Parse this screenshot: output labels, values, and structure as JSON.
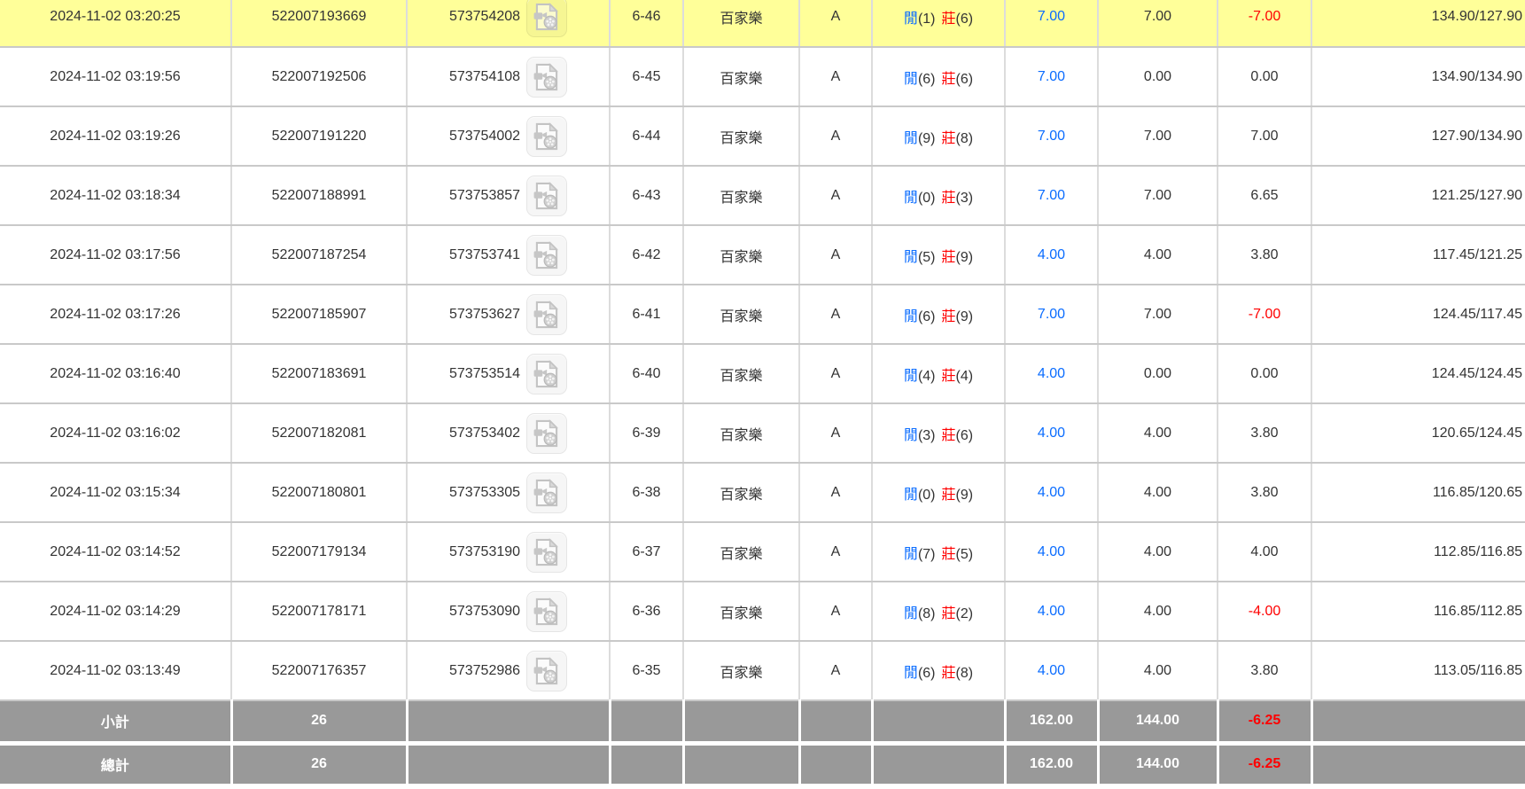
{
  "result_labels": {
    "player": "閒",
    "banker": "莊"
  },
  "icons": {
    "video": "video-file-icon"
  },
  "colors": {
    "highlight_yellow": "#ffff99",
    "bet_blue": "#0a6cff",
    "loss_red": "#ff0000",
    "summary_gray": "#999999",
    "text": "#333333"
  },
  "rows": [
    {
      "highlight": true,
      "time": "2024-11-02 03:20:25",
      "order_id": "522007193669",
      "round_id": "573754208",
      "round_no": "6-46",
      "game": "百家樂",
      "table": "A",
      "player_score": "(1)",
      "banker_score": "(6)",
      "bet": "7.00",
      "valid_bet": "7.00",
      "win_loss": "-7.00",
      "balance": "134.90/127.90"
    },
    {
      "highlight": false,
      "time": "2024-11-02 03:19:56",
      "order_id": "522007192506",
      "round_id": "573754108",
      "round_no": "6-45",
      "game": "百家樂",
      "table": "A",
      "player_score": "(6)",
      "banker_score": "(6)",
      "bet": "7.00",
      "valid_bet": "0.00",
      "win_loss": "0.00",
      "balance": "134.90/134.90"
    },
    {
      "highlight": false,
      "time": "2024-11-02 03:19:26",
      "order_id": "522007191220",
      "round_id": "573754002",
      "round_no": "6-44",
      "game": "百家樂",
      "table": "A",
      "player_score": "(9)",
      "banker_score": "(8)",
      "bet": "7.00",
      "valid_bet": "7.00",
      "win_loss": "7.00",
      "balance": "127.90/134.90"
    },
    {
      "highlight": false,
      "time": "2024-11-02 03:18:34",
      "order_id": "522007188991",
      "round_id": "573753857",
      "round_no": "6-43",
      "game": "百家樂",
      "table": "A",
      "player_score": "(0)",
      "banker_score": "(3)",
      "bet": "7.00",
      "valid_bet": "7.00",
      "win_loss": "6.65",
      "balance": "121.25/127.90"
    },
    {
      "highlight": false,
      "time": "2024-11-02 03:17:56",
      "order_id": "522007187254",
      "round_id": "573753741",
      "round_no": "6-42",
      "game": "百家樂",
      "table": "A",
      "player_score": "(5)",
      "banker_score": "(9)",
      "bet": "4.00",
      "valid_bet": "4.00",
      "win_loss": "3.80",
      "balance": "117.45/121.25"
    },
    {
      "highlight": false,
      "time": "2024-11-02 03:17:26",
      "order_id": "522007185907",
      "round_id": "573753627",
      "round_no": "6-41",
      "game": "百家樂",
      "table": "A",
      "player_score": "(6)",
      "banker_score": "(9)",
      "bet": "7.00",
      "valid_bet": "7.00",
      "win_loss": "-7.00",
      "balance": "124.45/117.45"
    },
    {
      "highlight": false,
      "time": "2024-11-02 03:16:40",
      "order_id": "522007183691",
      "round_id": "573753514",
      "round_no": "6-40",
      "game": "百家樂",
      "table": "A",
      "player_score": "(4)",
      "banker_score": "(4)",
      "bet": "4.00",
      "valid_bet": "0.00",
      "win_loss": "0.00",
      "balance": "124.45/124.45"
    },
    {
      "highlight": false,
      "time": "2024-11-02 03:16:02",
      "order_id": "522007182081",
      "round_id": "573753402",
      "round_no": "6-39",
      "game": "百家樂",
      "table": "A",
      "player_score": "(3)",
      "banker_score": "(6)",
      "bet": "4.00",
      "valid_bet": "4.00",
      "win_loss": "3.80",
      "balance": "120.65/124.45"
    },
    {
      "highlight": false,
      "time": "2024-11-02 03:15:34",
      "order_id": "522007180801",
      "round_id": "573753305",
      "round_no": "6-38",
      "game": "百家樂",
      "table": "A",
      "player_score": "(0)",
      "banker_score": "(9)",
      "bet": "4.00",
      "valid_bet": "4.00",
      "win_loss": "3.80",
      "balance": "116.85/120.65"
    },
    {
      "highlight": false,
      "time": "2024-11-02 03:14:52",
      "order_id": "522007179134",
      "round_id": "573753190",
      "round_no": "6-37",
      "game": "百家樂",
      "table": "A",
      "player_score": "(7)",
      "banker_score": "(5)",
      "bet": "4.00",
      "valid_bet": "4.00",
      "win_loss": "4.00",
      "balance": "112.85/116.85"
    },
    {
      "highlight": false,
      "time": "2024-11-02 03:14:29",
      "order_id": "522007178171",
      "round_id": "573753090",
      "round_no": "6-36",
      "game": "百家樂",
      "table": "A",
      "player_score": "(8)",
      "banker_score": "(2)",
      "bet": "4.00",
      "valid_bet": "4.00",
      "win_loss": "-4.00",
      "balance": "116.85/112.85"
    },
    {
      "highlight": false,
      "time": "2024-11-02 03:13:49",
      "order_id": "522007176357",
      "round_id": "573752986",
      "round_no": "6-35",
      "game": "百家樂",
      "table": "A",
      "player_score": "(6)",
      "banker_score": "(8)",
      "bet": "4.00",
      "valid_bet": "4.00",
      "win_loss": "3.80",
      "balance": "113.05/116.85"
    }
  ],
  "summary": {
    "subtotal": {
      "label": "小計",
      "count": "26",
      "bet_total": "162.00",
      "valid_bet_total": "144.00",
      "net": "-6.25"
    },
    "total": {
      "label": "總計",
      "count": "26",
      "bet_total": "162.00",
      "valid_bet_total": "144.00",
      "net": "-6.25"
    }
  }
}
